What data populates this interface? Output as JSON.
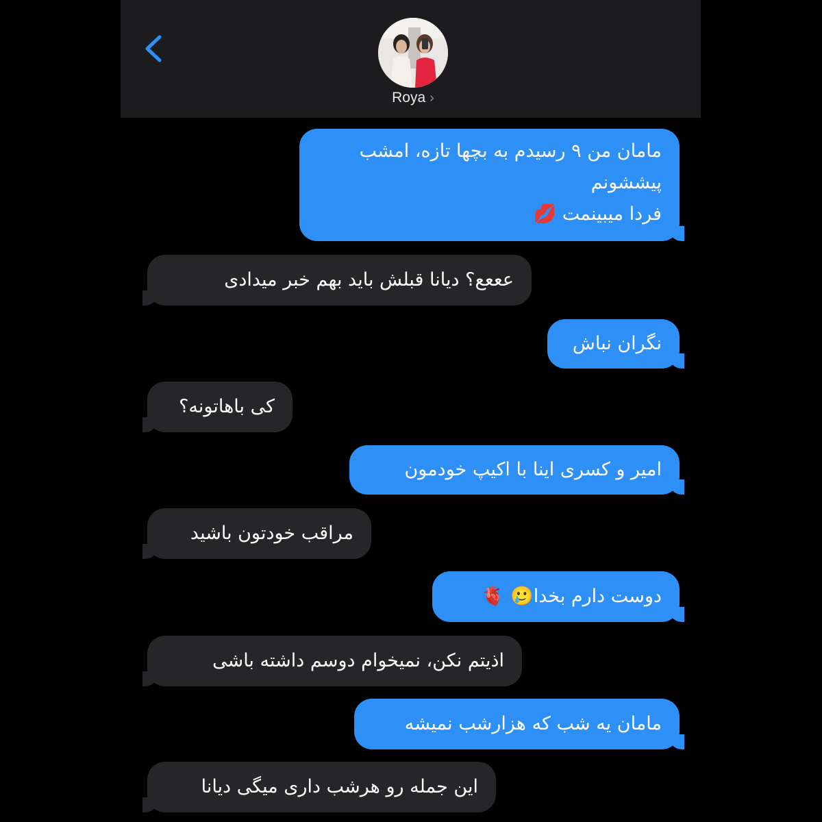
{
  "header": {
    "contact_name": "Roya",
    "chevron": "›",
    "back_icon": "chevron-left-icon",
    "accent_color": "#2e8ff7"
  },
  "messages": [
    {
      "direction": "sent",
      "lines": [
        "مامان من ۹ رسیدم به بچها تازه، امشب",
        "پیششونم",
        "فردا میبینمت 💋"
      ]
    },
    {
      "direction": "received",
      "text": "عععع؟ دیانا قبلش باید بهم خبر میدادی"
    },
    {
      "direction": "sent",
      "text": "نگران نباش"
    },
    {
      "direction": "received",
      "text": "کی باهاتونه؟"
    },
    {
      "direction": "sent",
      "text": "امیر و کسری اینا با اکیپ خودمون"
    },
    {
      "direction": "received",
      "text": "مراقب خودتون باشید"
    },
    {
      "direction": "sent",
      "text": "دوست دارم بخدا🥲 🫀"
    },
    {
      "direction": "received",
      "text": "اذیتم نکن، نمیخوام دوسم داشته باشی"
    },
    {
      "direction": "sent",
      "text": "مامان یه شب که هزارشب نمیشه"
    },
    {
      "direction": "received",
      "text": "این جمله رو هرشب داری میگی دیانا"
    }
  ]
}
